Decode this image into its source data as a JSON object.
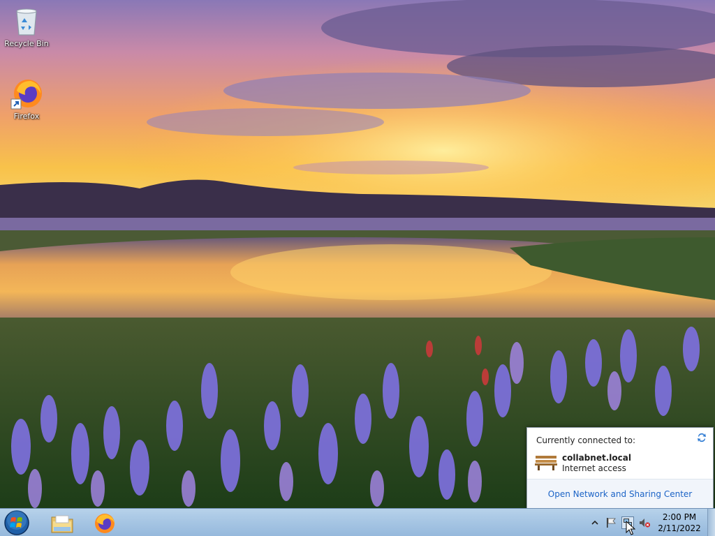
{
  "desktop": {
    "icons": [
      {
        "label": "Recycle Bin",
        "icon": "recycle-bin-icon"
      },
      {
        "label": "Firefox",
        "icon": "firefox-icon"
      }
    ]
  },
  "network_flyout": {
    "header": "Currently connected to:",
    "network_name": "collabnet.local",
    "network_status": "Internet access",
    "footer_link": "Open Network and Sharing Center"
  },
  "taskbar": {
    "pinned": [
      {
        "name": "Windows Explorer",
        "icon": "folder-icon"
      },
      {
        "name": "Firefox",
        "icon": "firefox-icon"
      }
    ],
    "tray": {
      "icons": [
        "show-hidden-icons-chevron",
        "action-center-flag-icon",
        "network-icon",
        "volume-muted-icon"
      ]
    },
    "clock": {
      "time": "2:00 PM",
      "date": "2/11/2022"
    }
  },
  "colors": {
    "taskbar": "#a7c6e4",
    "link": "#1b63c6",
    "flyout_footer": "#f1f5fb"
  }
}
